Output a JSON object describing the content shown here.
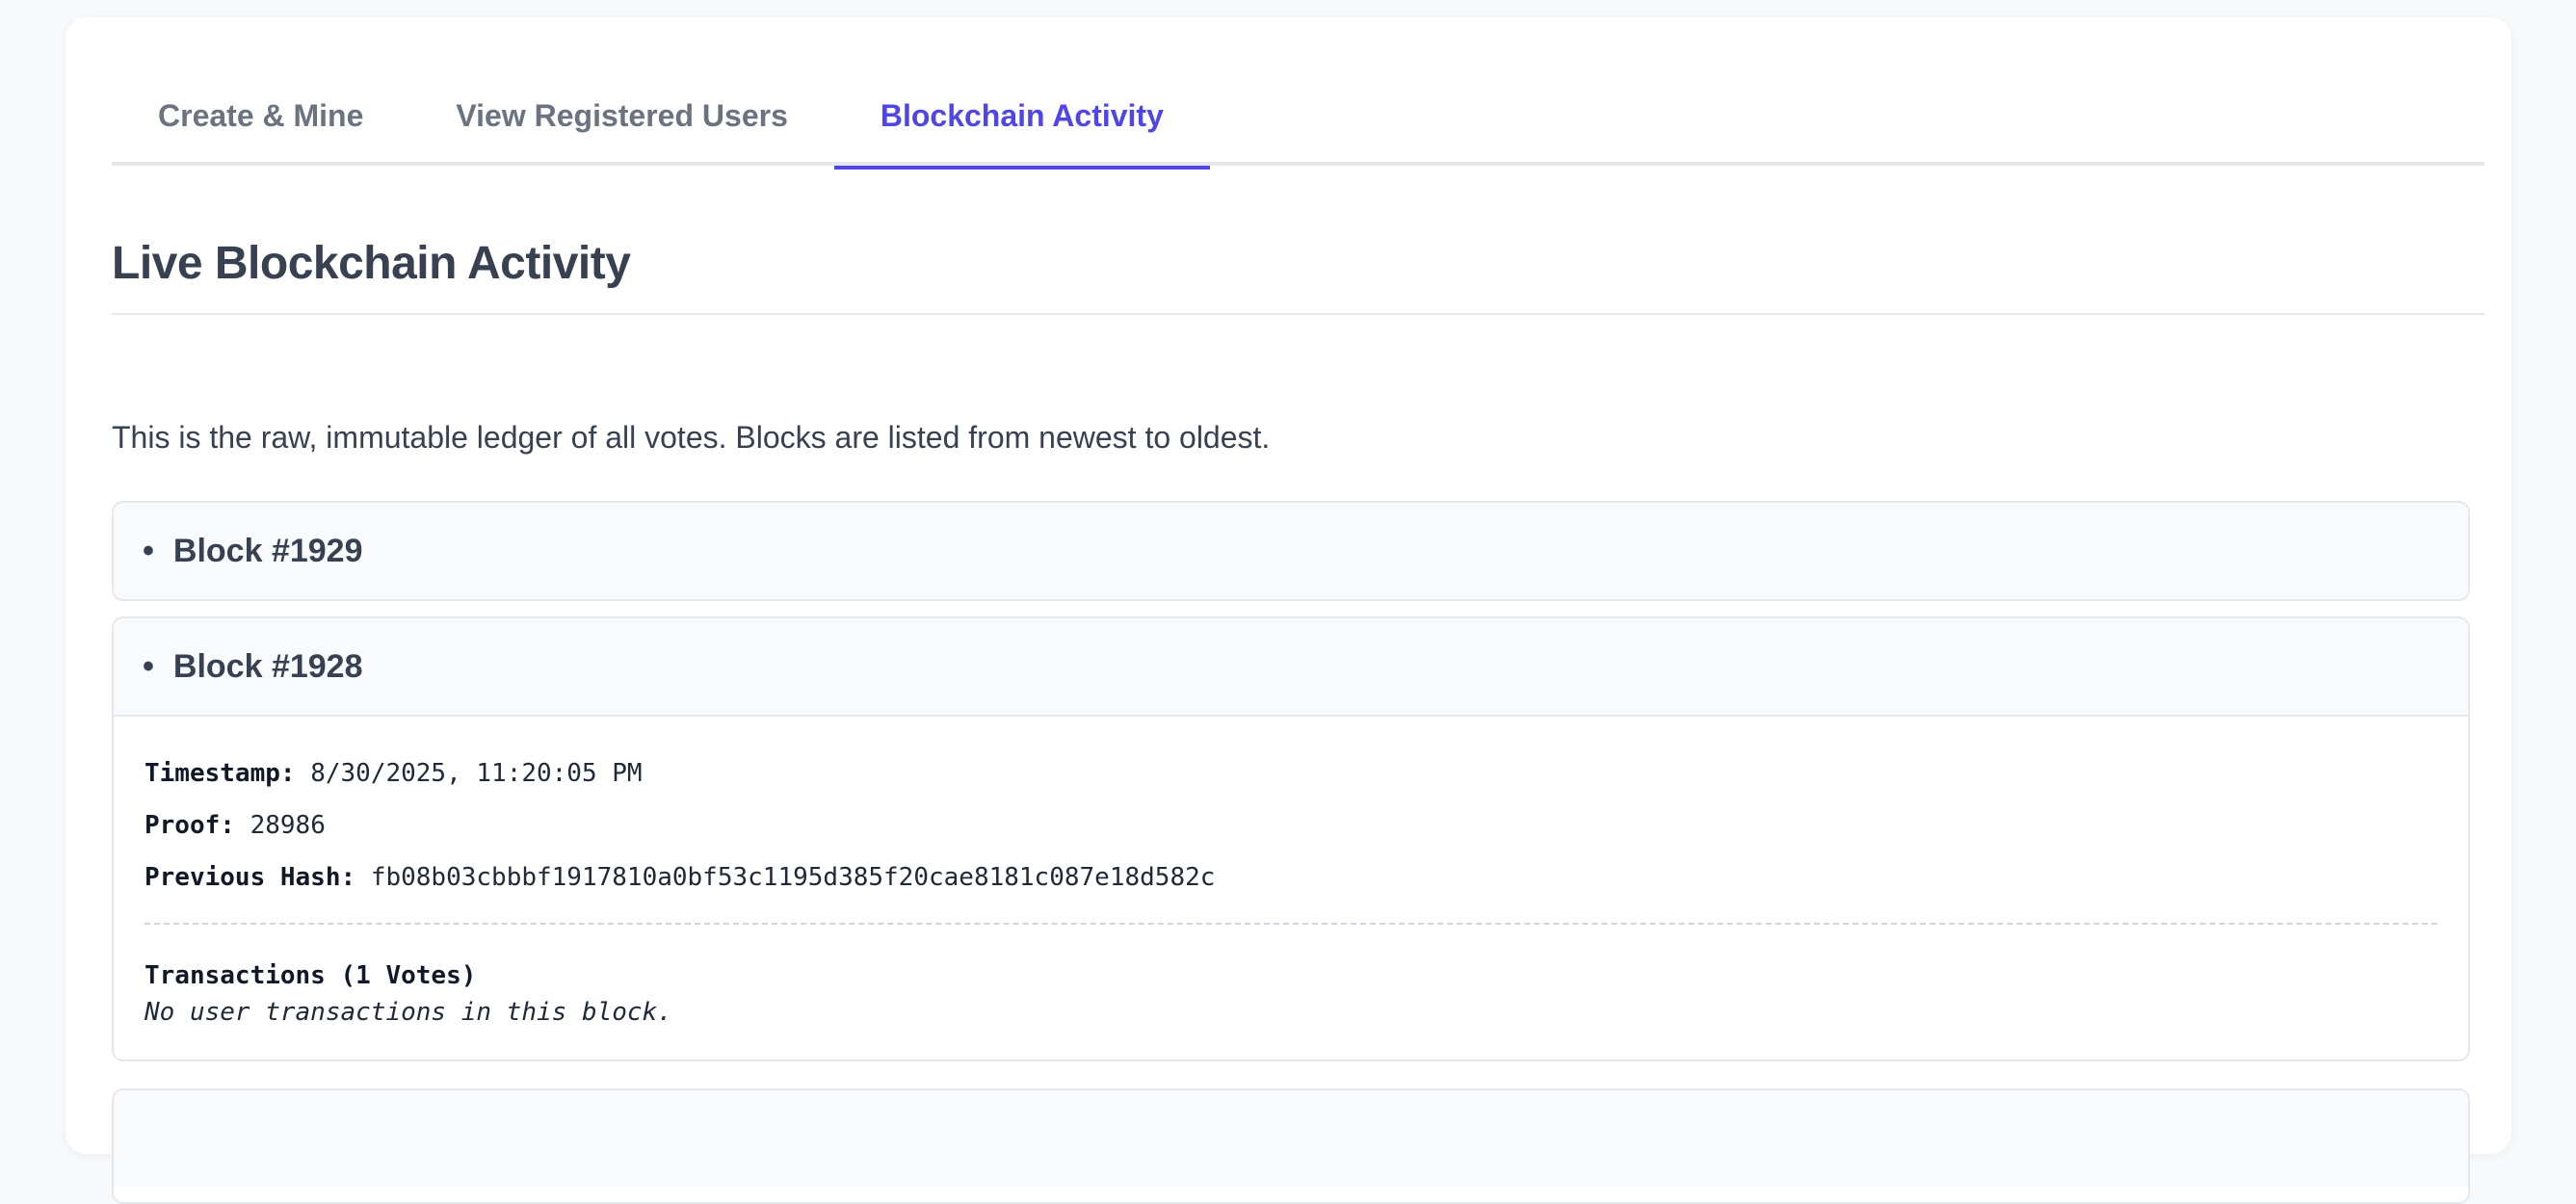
{
  "tabs": [
    {
      "label": "Create & Mine",
      "active": false
    },
    {
      "label": "View Registered Users",
      "active": false
    },
    {
      "label": "Blockchain Activity",
      "active": true
    }
  ],
  "heading": "Live Blockchain Activity",
  "description": "This is the raw, immutable ledger of all votes. Blocks are listed from newest to oldest.",
  "blocks": [
    {
      "title": "Block #1929",
      "expanded": false
    },
    {
      "title": "Block #1928",
      "expanded": true,
      "timestamp_label": "Timestamp:",
      "timestamp": "8/30/2025, 11:20:05 PM",
      "proof_label": "Proof:",
      "proof": "28986",
      "prev_hash_label": "Previous Hash:",
      "prev_hash": "fb08b03cbbbf1917810a0bf53c1195d385f20cae8181c087e18d582c",
      "transactions_title": "Transactions (1 Votes)",
      "transactions_empty": "No user transactions in this block."
    }
  ],
  "colors": {
    "accent": "#4f46e5",
    "text": "#374151",
    "muted": "#6b7280"
  },
  "icons": {
    "bullet": "bullet-icon"
  }
}
